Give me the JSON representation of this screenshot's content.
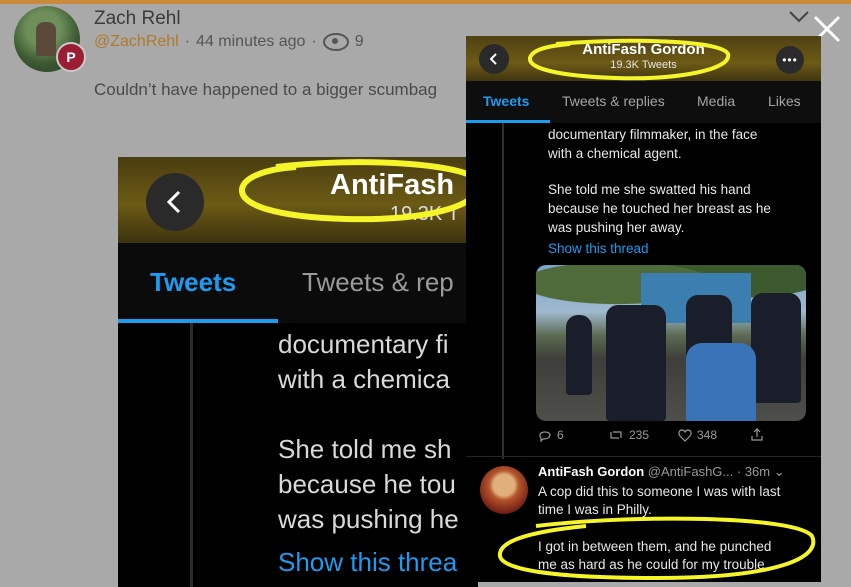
{
  "post": {
    "author_name": "Zach Rehl",
    "handle": "@ZachRehl",
    "separator": "·",
    "time_ago": "44 minutes ago",
    "views": "9",
    "text": "Couldn’t have happened to a bigger scumbag",
    "badge": "P"
  },
  "tweet": {
    "account_name": "AntiFash Gordon",
    "tweet_count": "19.3K Tweets",
    "tabs": [
      "Tweets",
      "Tweets & replies",
      "Media",
      "Likes"
    ],
    "body_lines": [
      "documentary filmmaker, in the face",
      "with a chemical agent.",
      "",
      "She told me she swatted his hand",
      "because he touched her breast as he",
      "was pushing her away."
    ],
    "show_thread": "Show this thread",
    "actions": {
      "replies": "6",
      "retweets": "235",
      "likes": "348"
    },
    "reply": {
      "name": "AntiFash Gordon",
      "handle": "@AntiFashG...",
      "time": "· 36m",
      "lines": [
        "A cop did this to someone I was with last",
        "time I was in Philly.",
        "",
        "I got in between them, and he punched",
        "me as hard as he could for my trouble."
      ]
    }
  },
  "big": {
    "title_partial": "AntiFash",
    "sub_partial": "19.3K T",
    "tab1": "Tweets",
    "tab2_partial": "Tweets & rep",
    "lines": [
      "documentary fi",
      "with a chemica",
      "",
      "She told me sh",
      "because he tou",
      "was pushing he"
    ],
    "link_partial": "Show this threa"
  },
  "colors": {
    "highlight": "#f5f52a",
    "link": "#1d9bf0",
    "accent": "#c98a3b"
  }
}
